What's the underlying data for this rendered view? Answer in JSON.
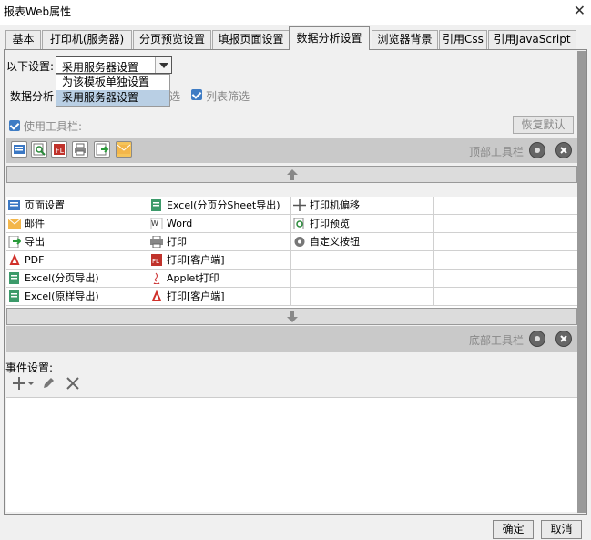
{
  "window": {
    "title": "报表Web属性",
    "close_glyph": "✕"
  },
  "tabs": [
    {
      "label": "基本"
    },
    {
      "label": "打印机(服务器)"
    },
    {
      "label": "分页预览设置"
    },
    {
      "label": "填报页面设置"
    },
    {
      "label": "数据分析设置"
    },
    {
      "label": "浏览器背景"
    },
    {
      "label": "引用Css"
    },
    {
      "label": "引用JavaScript"
    }
  ],
  "settings": {
    "label": "以下设置:",
    "selected": "采用服务器设置",
    "options": [
      "为该模板单独设置",
      "采用服务器设置"
    ]
  },
  "data_analysis": {
    "label_partial": "数据分析",
    "hidden_suffix": "选",
    "list_filter": "列表筛选"
  },
  "toolbar_section": {
    "use_toolbar": "使用工具栏:",
    "restore_default": "恢复默认",
    "top_toolbar": "顶部工具栏",
    "bottom_toolbar": "底部工具栏"
  },
  "grid": [
    [
      {
        "label": "页面设置",
        "icon": "page-setup-icon"
      },
      {
        "label": "Excel(分页分Sheet导出)",
        "icon": "excel-icon"
      },
      {
        "label": "打印机偏移",
        "icon": "move-icon"
      }
    ],
    [
      {
        "label": "邮件",
        "icon": "mail-icon"
      },
      {
        "label": "Word",
        "icon": "word-icon"
      },
      {
        "label": "打印预览",
        "icon": "print-preview-icon"
      }
    ],
    [
      {
        "label": "导出",
        "icon": "export-icon"
      },
      {
        "label": "打印",
        "icon": "printer-icon"
      },
      {
        "label": "自定义按钮",
        "icon": "gear-icon"
      }
    ],
    [
      {
        "label": "PDF",
        "icon": "pdf-icon"
      },
      {
        "label": "打印[客户端]",
        "icon": "flash-print-icon"
      },
      {
        "label": "",
        "icon": ""
      }
    ],
    [
      {
        "label": "Excel(分页导出)",
        "icon": "excel-icon"
      },
      {
        "label": "Applet打印",
        "icon": "java-icon"
      },
      {
        "label": "",
        "icon": ""
      }
    ],
    [
      {
        "label": "Excel(原样导出)",
        "icon": "excel-icon"
      },
      {
        "label": "打印[客户端]",
        "icon": "pdf-print-icon"
      },
      {
        "label": "",
        "icon": ""
      }
    ]
  ],
  "events": {
    "label": "事件设置:"
  },
  "footer": {
    "ok": "确定",
    "cancel": "取消"
  }
}
